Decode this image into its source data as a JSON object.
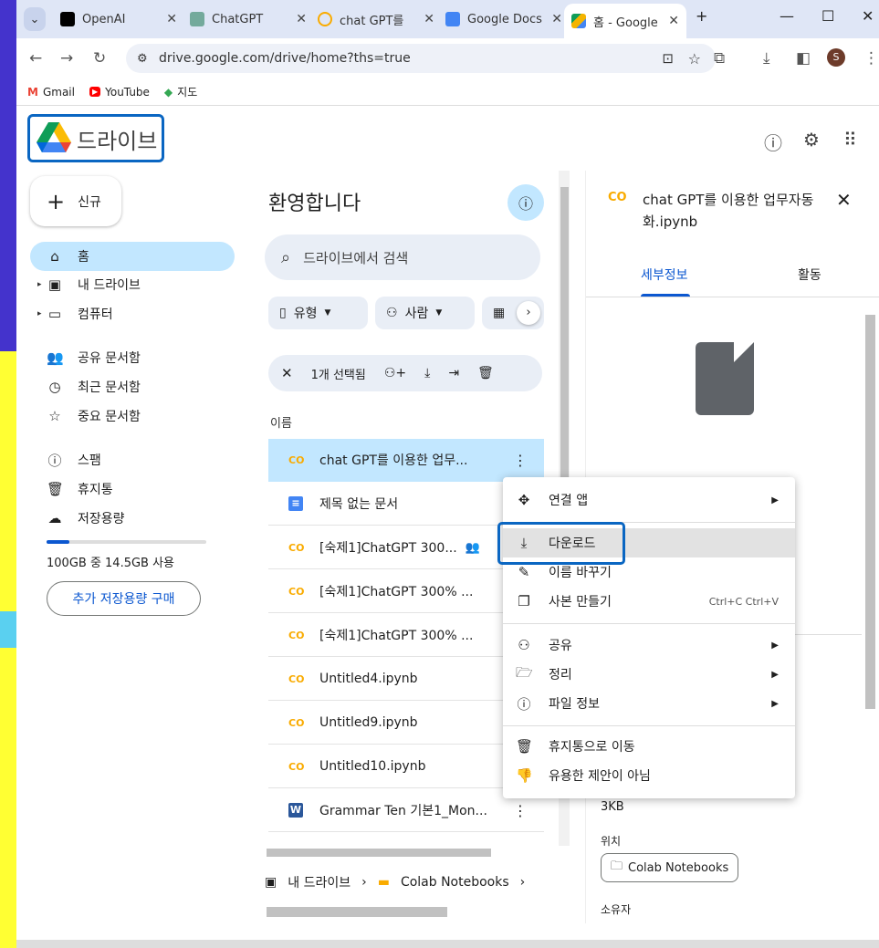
{
  "browser": {
    "tabs": [
      {
        "label": "OpenAI",
        "icon": "openai-icon"
      },
      {
        "label": "ChatGPT",
        "icon": "chatgpt-icon"
      },
      {
        "label": "chat GPT를",
        "icon": "colab-icon"
      },
      {
        "label": "Google Docs",
        "icon": "docs-icon"
      },
      {
        "label": "홈 - Google",
        "icon": "drive-icon"
      }
    ],
    "url": "drive.google.com/drive/home?ths=true",
    "profile_initial": "S",
    "bookmarks": [
      "Gmail",
      "YouTube",
      "지도"
    ]
  },
  "drive": {
    "title": "드라이브",
    "new_label": "신규",
    "nav": [
      {
        "label": "홈",
        "icon": "home-icon"
      },
      {
        "label": "내 드라이브",
        "icon": "my-drive-icon"
      },
      {
        "label": "컴퓨터",
        "icon": "computer-icon"
      },
      {
        "label": "공유 문서함",
        "icon": "shared-icon"
      },
      {
        "label": "최근 문서함",
        "icon": "recent-icon"
      },
      {
        "label": "중요 문서함",
        "icon": "star-icon"
      },
      {
        "label": "스팸",
        "icon": "spam-icon"
      },
      {
        "label": "휴지통",
        "icon": "trash-icon"
      },
      {
        "label": "저장용량",
        "icon": "cloud-icon"
      }
    ],
    "storage_text": "100GB 중 14.5GB 사용",
    "storage_fraction": 0.145,
    "buy_storage": "추가 저장용량 구매"
  },
  "main": {
    "greeting": "환영합니다",
    "search_placeholder": "드라이브에서 검색",
    "chips": [
      "유형",
      "사람"
    ],
    "selected_text": "1개 선택됨",
    "column_name": "이름",
    "files": [
      {
        "name": "chat GPT를 이용한 업무...",
        "type": "colab"
      },
      {
        "name": "제목 없는 문서",
        "type": "doc"
      },
      {
        "name": "[숙제1]ChatGPT 300...",
        "type": "colab"
      },
      {
        "name": "[숙제1]ChatGPT 300% ...",
        "type": "colab"
      },
      {
        "name": "[숙제1]ChatGPT 300% ...",
        "type": "colab"
      },
      {
        "name": "Untitled4.ipynb",
        "type": "colab"
      },
      {
        "name": "Untitled9.ipynb",
        "type": "colab"
      },
      {
        "name": "Untitled10.ipynb",
        "type": "colab"
      },
      {
        "name": "Grammar Ten 기본1_Mon...",
        "type": "word"
      }
    ],
    "breadcrumb": [
      "내 드라이브",
      "Colab Notebooks"
    ]
  },
  "details": {
    "title": "chat GPT를 이용한 업무자동화.ipynb",
    "tabs": [
      "세부정보",
      "활동"
    ],
    "size": "3KB",
    "location_label": "위치",
    "location_value": "Colab Notebooks",
    "owner_label": "소유자"
  },
  "menu": {
    "items": [
      {
        "label": "연결 앱",
        "icon": "move-icon",
        "submenu": true
      },
      {
        "label": "다운로드",
        "icon": "download-icon"
      },
      {
        "label": "이름 바꾸기",
        "icon": "rename-icon"
      },
      {
        "label": "사본 만들기",
        "icon": "copy-icon",
        "shortcut": "Ctrl+C Ctrl+V"
      },
      {
        "label": "공유",
        "icon": "share-icon",
        "submenu": true
      },
      {
        "label": "정리",
        "icon": "organize-icon",
        "submenu": true
      },
      {
        "label": "파일 정보",
        "icon": "info-icon",
        "submenu": true
      },
      {
        "label": "휴지통으로 이동",
        "icon": "trash-icon"
      },
      {
        "label": "유용한 제안이 아님",
        "icon": "thumb-down-icon"
      }
    ]
  },
  "colors": {
    "accent": "#0b57d0",
    "selected": "#c2e7ff",
    "highlight_box": "#0a66c2"
  }
}
